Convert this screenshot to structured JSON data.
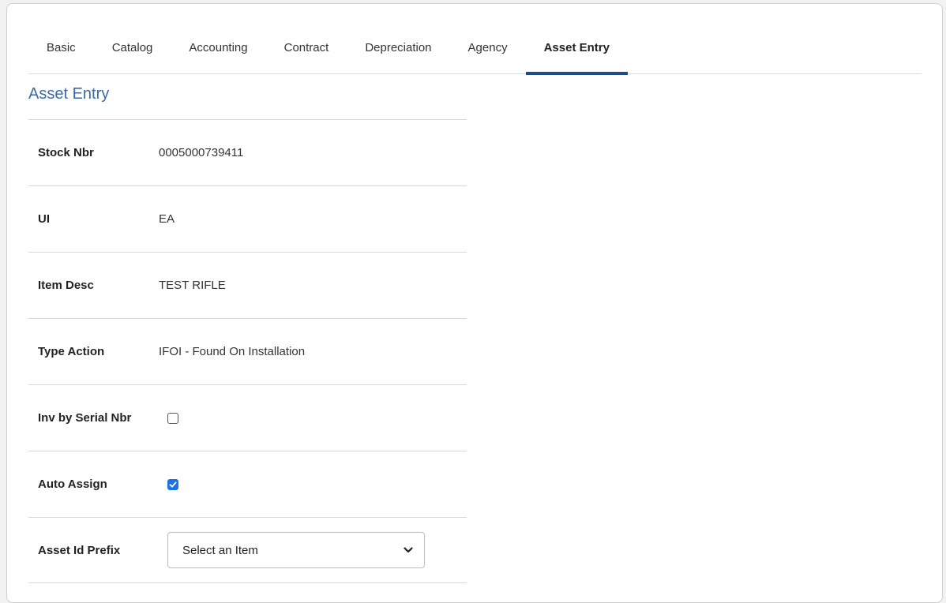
{
  "tabs": [
    {
      "label": "Basic",
      "active": false
    },
    {
      "label": "Catalog",
      "active": false
    },
    {
      "label": "Accounting",
      "active": false
    },
    {
      "label": "Contract",
      "active": false
    },
    {
      "label": "Depreciation",
      "active": false
    },
    {
      "label": "Agency",
      "active": false
    },
    {
      "label": "Asset Entry",
      "active": true
    }
  ],
  "section": {
    "title": "Asset Entry"
  },
  "fields": {
    "stock_nbr": {
      "label": "Stock Nbr",
      "value": "0005000739411"
    },
    "ui": {
      "label": "UI",
      "value": "EA"
    },
    "item_desc": {
      "label": "Item Desc",
      "value": "TEST RIFLE"
    },
    "type_action": {
      "label": "Type Action",
      "value": "IFOI - Found On Installation"
    },
    "inv_by_serial": {
      "label": "Inv by Serial Nbr",
      "checked": false
    },
    "auto_assign": {
      "label": "Auto Assign",
      "checked": true
    },
    "asset_id_prefix": {
      "label": "Asset Id Prefix",
      "selected": "Select an Item"
    }
  },
  "colors": {
    "accent": "#1f4e82",
    "section_title": "#3a6aa5",
    "checkbox_checked": "#1a73e8"
  }
}
